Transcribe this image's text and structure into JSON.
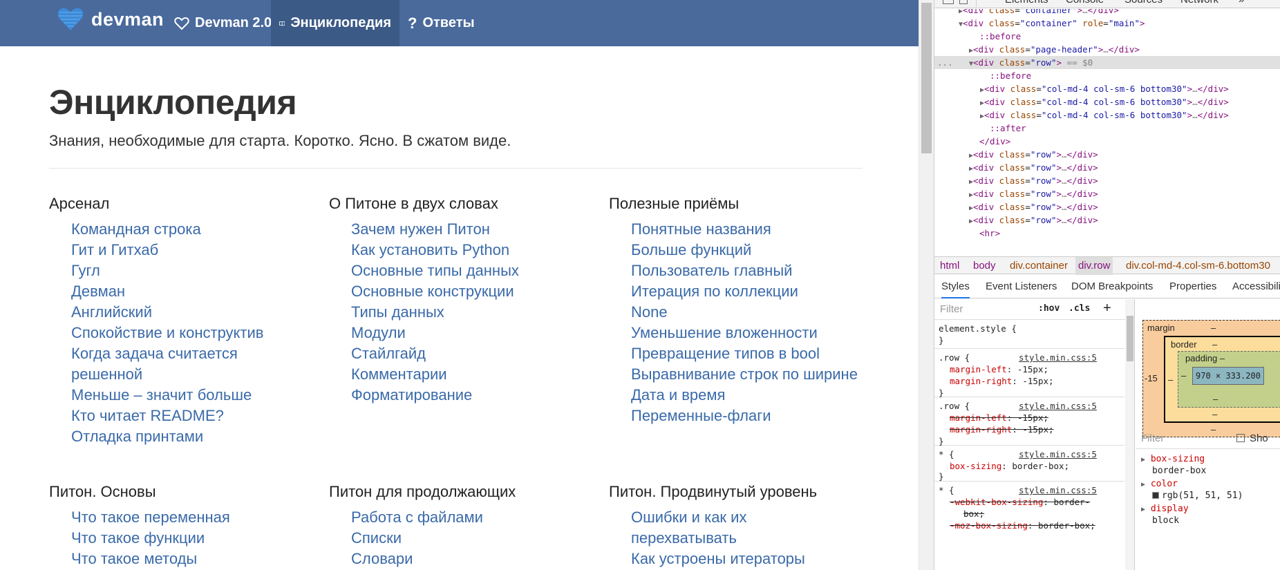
{
  "navbar": {
    "brand": "devman",
    "items": [
      {
        "label": "Devman 2.0",
        "icon": "heart-outline-icon"
      },
      {
        "label": "Энциклопедия",
        "icon": "book-icon"
      },
      {
        "label": "Ответы",
        "icon": "question-icon"
      }
    ]
  },
  "page": {
    "title": "Энциклопедия",
    "subtitle": "Знания, необходимые для старта. Коротко. Ясно. В сжатом виде."
  },
  "sections": [
    {
      "title": "Арсенал",
      "items": [
        "Командная строка",
        "Гит и Гитхаб",
        "Гугл",
        "Девман",
        "Английский",
        "Спокойствие и конструктив",
        "Когда задача считается",
        "решенной",
        "Меньше – значит больше",
        "Кто читает README?",
        "Отладка принтами"
      ]
    },
    {
      "title": "О Питоне в двух словах",
      "items": [
        "Зачем нужен Питон",
        "Как установить Python",
        "Основные типы данных",
        "Основные конструкции",
        "Типы данных",
        "Модули",
        "Стайлгайд",
        "Комментарии",
        "Форматирование"
      ]
    },
    {
      "title": "Полезные приёмы",
      "items": [
        "Понятные названия",
        "Больше функций",
        "Пользователь главный",
        "Итерация по коллекции",
        "None",
        "Уменьшение вложенности",
        "Превращение типов в bool",
        "Выравнивание строк по ширине",
        "Дата и время",
        "Переменные-флаги"
      ]
    },
    {
      "title": "Питон. Основы",
      "items": [
        "Что такое переменная",
        "Что такое функции",
        "Что такое методы"
      ]
    },
    {
      "title": "Питон для продолжающих",
      "items": [
        "Работа с файлами",
        "Списки",
        "Словари"
      ]
    },
    {
      "title": "Питон. Продвинутый уровень",
      "items": [
        "Ошибки и как их",
        "перехватывать",
        "Как устроены итераторы"
      ]
    }
  ],
  "devtools": {
    "tabs": [
      "Elements",
      "Console",
      "Sources",
      "Network",
      "»"
    ],
    "dom": {
      "container_collapsed_tag": "div",
      "container_collapsed_attr": "class",
      "container_collapsed_val": "\"container\"",
      "main_attr_class": "\"container\"",
      "main_attr_role": "\"main\"",
      "before": "::before",
      "page_header_val": "\"page-header\"",
      "row_val": "\"row\"",
      "row_sel_marker": "== $0",
      "col_val": "\"col-md-4 col-sm-6 bottom30\"",
      "after": "::after",
      "ellipsis": "…",
      "dots": "...",
      "hr": "<hr>"
    },
    "breadcrumbs": [
      "html",
      "body",
      "div.container",
      "div.row",
      "div.col-md-4.col-sm-6.bottom30"
    ],
    "panel_tabs": [
      "Styles",
      "Event Listeners",
      "DOM Breakpoints",
      "Properties",
      "Accessibili"
    ],
    "styles": {
      "filter_placeholder": "Filter",
      "hov": ":hov",
      "cls": ".cls",
      "plus": "+",
      "element_style": "element.style {",
      "close": "}",
      "source": "style.min.css:5",
      "rule_row": ".row {",
      "rule_star": "* {",
      "margin_left": "margin-left",
      "margin_right": "margin-right",
      "margin_val": "-15px;",
      "box_sizing": "box-sizing",
      "border_box": "border-box;",
      "webkit_box_sizing": "-webkit-box-sizing",
      "webkit_val": "border-",
      "webkit_val2": "box;",
      "moz_box_sizing": "-moz-box-sizing",
      "moz_val": "border-box;"
    },
    "box_model": {
      "margin": "margin",
      "border": "border",
      "padding": "padding",
      "content": "970 × 333.200",
      "dash": "–",
      "left_margin": "-15"
    },
    "computed": {
      "filter_placeholder": "Filter",
      "show_all": "Sho",
      "box_sizing_prop": "box-sizing",
      "box_sizing_val": "border-box",
      "color_prop": "color",
      "color_val": "rgb(51, 51, 51)",
      "display_prop": "display",
      "display_val": "block"
    }
  }
}
